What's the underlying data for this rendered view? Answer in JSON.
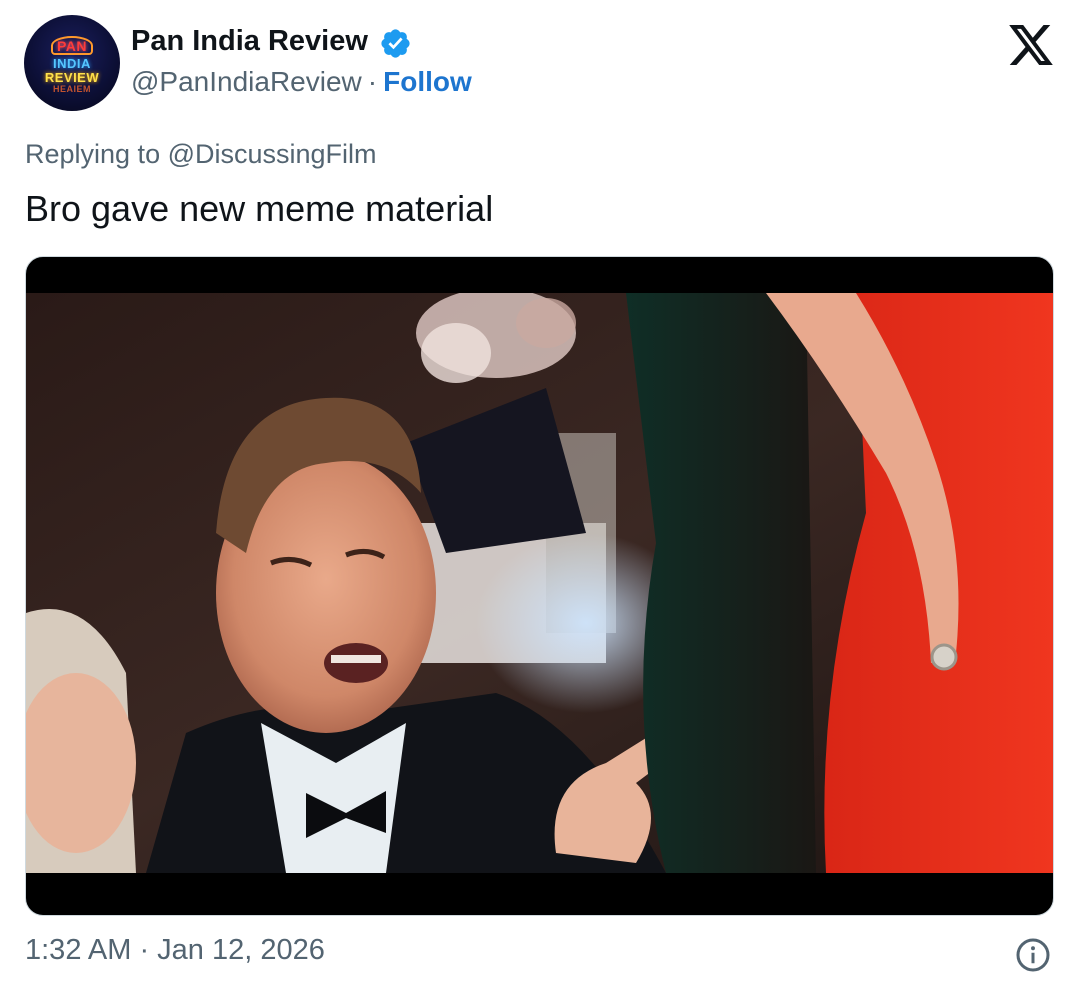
{
  "account": {
    "display_name": "Pan India Review",
    "handle": "@PanIndiaReview",
    "separator": "·",
    "follow_label": "Follow",
    "verified_color": "#1d9bf0",
    "avatar": {
      "logo_pan": "PAN",
      "logo_india": "INDIA",
      "logo_review": "REVIEW",
      "logo_strip": "HEAIEM"
    }
  },
  "tweet": {
    "replying_prefix": "Replying to ",
    "replying_handle": "@DiscussingFilm",
    "text": "Bro gave new meme material"
  },
  "media": {
    "type": "video",
    "letterbox_color": "#000000"
  },
  "footer": {
    "timestamp": "1:32 AM · Jan 12, 2026"
  },
  "icons": {
    "verified": "verified-badge-icon",
    "x_logo": "x-logo-icon",
    "info": "info-icon"
  },
  "colors": {
    "text_primary": "#0f1419",
    "text_secondary": "#536471",
    "link": "#1d75cf",
    "border": "#cfd9de"
  }
}
